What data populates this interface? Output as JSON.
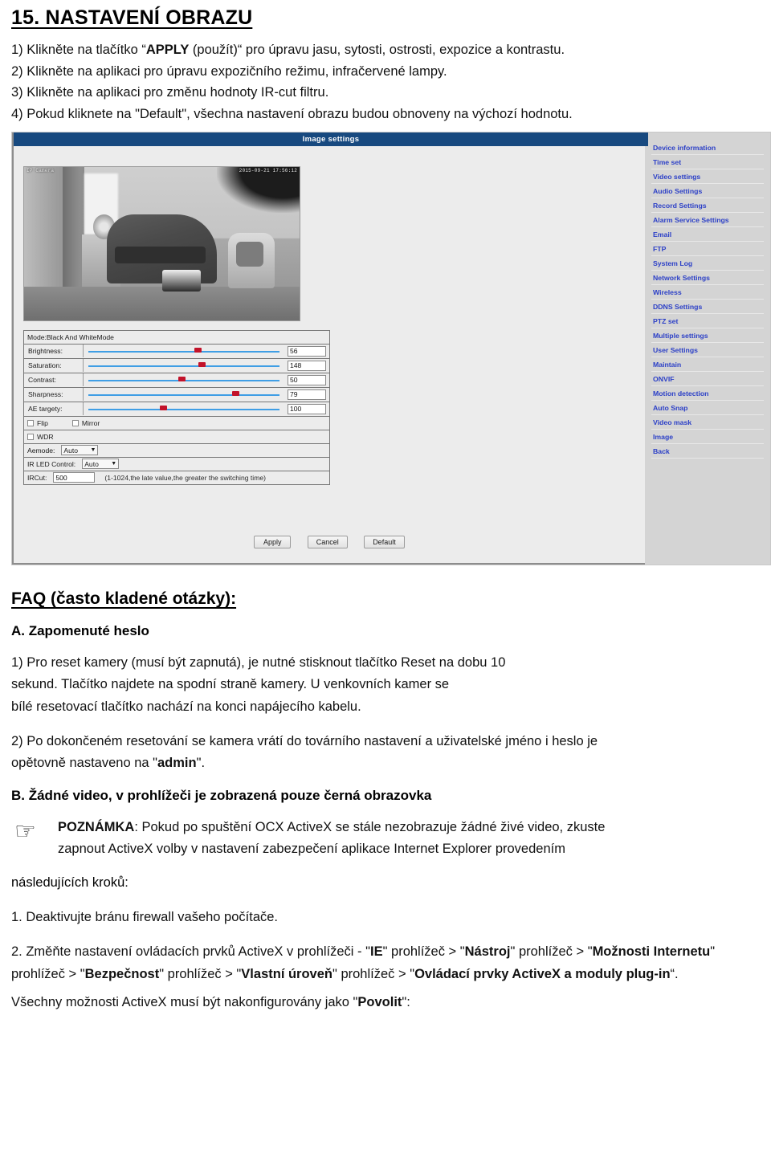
{
  "document": {
    "title": "15. NASTAVENÍ OBRAZU",
    "steps": [
      {
        "pre": "1) Klikněte na tlačítko “",
        "bold": "APPLY",
        "post": " (použít)“ pro úpravu jasu, sytosti, ostrosti, expozice a kontrastu."
      },
      {
        "pre": "2) Klikněte na aplikaci pro úpravu expozičního režimu, infračervené lampy.",
        "bold": "",
        "post": ""
      },
      {
        "pre": "3) Klikněte na aplikaci pro změnu hodnoty IR-cut filtru.",
        "bold": "",
        "post": ""
      },
      {
        "pre": "4) Pokud kliknete na \"Default\", všechna nastavení obrazu budou obnoveny na výchozí hodnotu.",
        "bold": "",
        "post": ""
      }
    ]
  },
  "screenshot": {
    "titlebar": "Image settings",
    "video": {
      "osd_left": "IP Camera",
      "osd_right": "2015-09-21 17:56:12"
    },
    "mode_label": "Mode:Black And WhiteMode",
    "sliders": [
      {
        "label": "Brightness:",
        "value": "56",
        "percent": 55
      },
      {
        "label": "Saturation:",
        "value": "148",
        "percent": 57
      },
      {
        "label": "Contrast:",
        "value": "50",
        "percent": 47
      },
      {
        "label": "Sharpness:",
        "value": "79",
        "percent": 74
      },
      {
        "label": "AE targety:",
        "value": "100",
        "percent": 38
      }
    ],
    "checkboxes": [
      {
        "label": "Flip",
        "checked": false
      },
      {
        "label": "Mirror",
        "checked": false
      },
      {
        "label": "WDR",
        "checked": false
      }
    ],
    "aemode": {
      "label": "Aemode:",
      "value": "Auto"
    },
    "irled": {
      "label": "IR LED Control:",
      "value": "Auto"
    },
    "ircut": {
      "label": "IRCut:",
      "value": "500",
      "hint": "(1-1024,the late value,the greater the switching time)"
    },
    "buttons": [
      "Apply",
      "Cancel",
      "Default"
    ],
    "menu": [
      "Device information",
      "Time set",
      "Video settings",
      "Audio Settings",
      "Record Settings",
      "Alarm Service Settings",
      "Email",
      "FTP",
      "System Log",
      "Network Settings",
      "Wireless",
      "DDNS Settings",
      "PTZ set",
      "Multiple settings",
      "User Settings",
      "Maintain",
      "ONVIF",
      "Motion detection",
      "Auto Snap",
      "Video mask",
      "Image",
      "Back"
    ],
    "colors": {
      "titlebar": "#17497f",
      "menu_link": "#2b3fc7",
      "slider_track": "#3f9ee5",
      "slider_thumb": "#c2122a"
    }
  },
  "faq": {
    "title": "FAQ (často kladené otázky):",
    "section_a": {
      "heading": "A. Zapomenuté heslo",
      "p1_line1": "1) Pro reset kamery (musí být zapnutá), je nutné stisknout tlačítko Reset na dobu 10",
      "p1_line2": "sekund. Tlačítko najdete na spodní straně kamery. U venkovních kamer se",
      "p1_line3": "bílé resetovací tlačítko nachází na konci napájecího kabelu.",
      "p2_line1": "2) Po dokončeném resetování se kamera vrátí do továrního nastavení a uživatelské jméno i heslo je",
      "p2_line2_pre": "opětovně nastaveno na \"",
      "p2_line2_bold": "admin",
      "p2_line2_post": "\"."
    },
    "section_b": {
      "heading": "B. Žádné video, v prohlížeči je zobrazená pouze černá obrazovka",
      "note_icon": "pointing-hand-icon",
      "note_bold": "POZNÁMKA",
      "note_line1": ": Pokud po spuštění OCX ActiveX se stále nezobrazuje žádné živé video, zkuste",
      "note_line2": "zapnout ActiveX volby v nastavení zabezpečení aplikace Internet Explorer provedením",
      "note_line3": "následujících kroků:",
      "step1": "1. Deaktivujte bránu firewall vašeho počítače.",
      "step2_parts": [
        {
          "text": "2. Změňte nastavení ovládacích prvků ActiveX v prohlížeči - \"",
          "bold": false
        },
        {
          "text": "IE",
          "bold": true
        },
        {
          "text": "\" prohlížeč  > \"",
          "bold": false
        },
        {
          "text": "Nástroj",
          "bold": true
        },
        {
          "text": "\" prohlížeč  > ",
          "bold": false
        },
        {
          "text": "\"",
          "bold": false
        },
        {
          "text": "Možnosti Internetu",
          "bold": true
        },
        {
          "text": "\" prohlížeč > \"",
          "bold": false
        },
        {
          "text": "Bezpečnost",
          "bold": true
        },
        {
          "text": "\" prohlížeč  > \"",
          "bold": false
        },
        {
          "text": "Vlastní úroveň",
          "bold": true
        },
        {
          "text": "\" prohlížeč > \"",
          "bold": false
        },
        {
          "text": "Ovládací prvky ActiveX a moduly plug-in",
          "bold": true
        },
        {
          "text": "“.",
          "bold": false
        }
      ],
      "closing_pre": "Všechny možnosti ActiveX musí být nakonfigurovány jako \"",
      "closing_bold": "Povolit",
      "closing_post": "\":"
    }
  }
}
